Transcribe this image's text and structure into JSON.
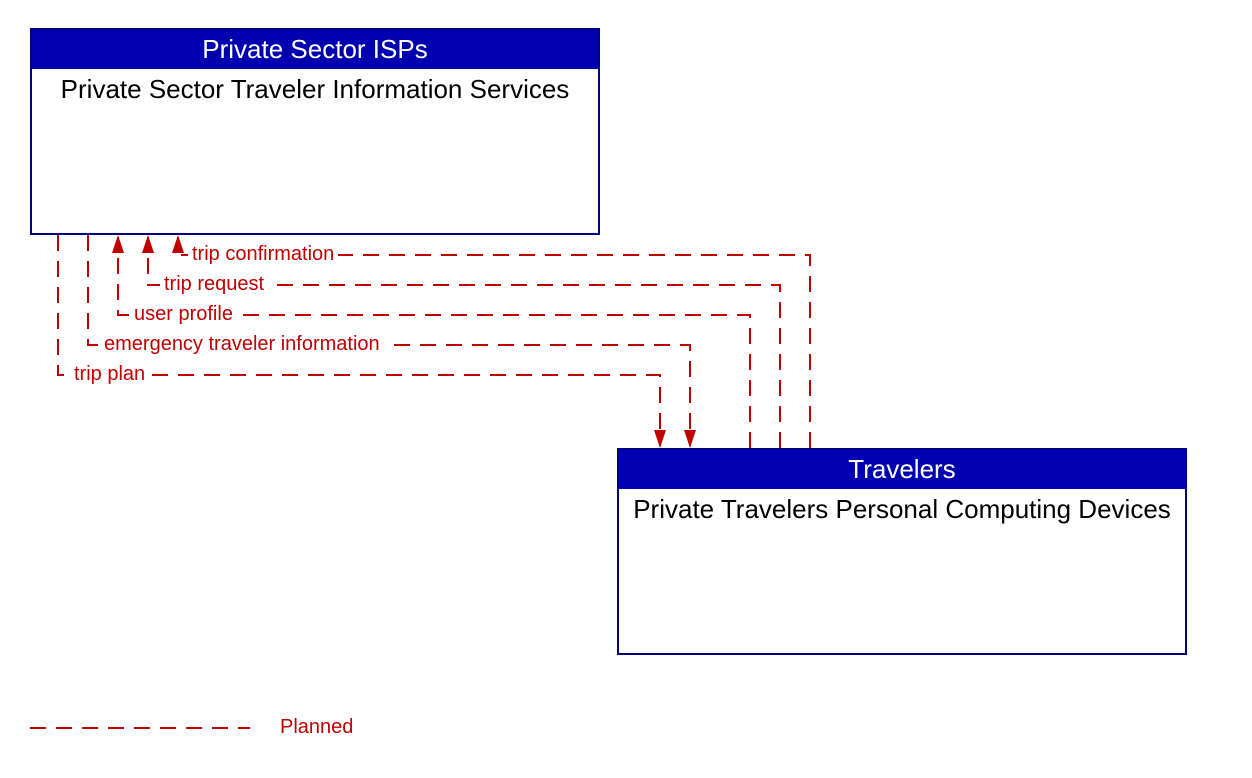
{
  "boxes": {
    "isp": {
      "header": "Private Sector ISPs",
      "body": "Private Sector Traveler Information Services"
    },
    "travelers": {
      "header": "Travelers",
      "body": "Private Travelers Personal Computing Devices"
    }
  },
  "flows": {
    "f1": "trip confirmation",
    "f2": "trip request",
    "f3": "user profile",
    "f4": "emergency traveler information",
    "f5": "trip plan"
  },
  "legend": {
    "planned": "Planned"
  },
  "colors": {
    "header_bg": "#0000b0",
    "border": "#000080",
    "flow": "#c00000"
  }
}
